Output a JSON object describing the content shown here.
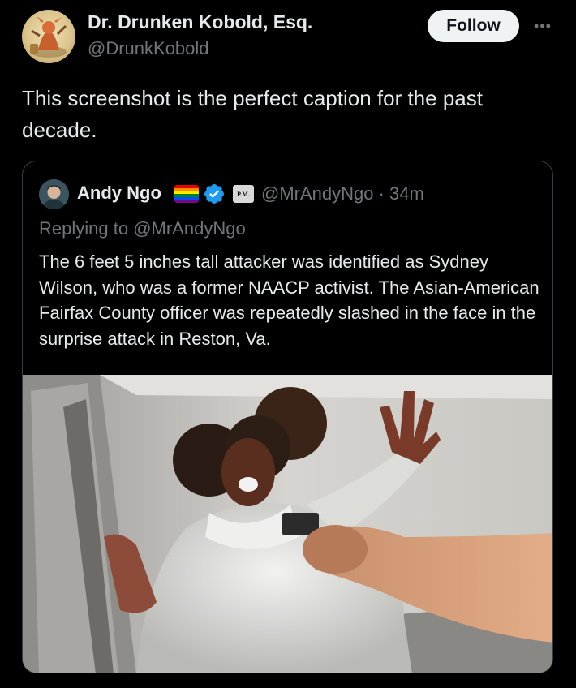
{
  "author": {
    "name": "Dr. Drunken Kobold, Esq.",
    "handle": "@DrunkKobold"
  },
  "actions": {
    "follow_label": "Follow",
    "more_label": "•••"
  },
  "tweet": {
    "text": "This screenshot is the perfect caption for the past decade."
  },
  "quoted": {
    "name": "Andy Ngo",
    "badge_text": "P.M.",
    "handle_time": "@MrAndyNgo · 34m",
    "replying_prefix": "Replying to ",
    "replying_mention": "@MrAndyNgo",
    "text": "The 6 feet 5 inches tall attacker was identified as Sydney Wilson, who was a former NAACP activist. The Asian-American Fairfax County officer was repeatedly slashed in the face in the surprise attack in Reston, Va."
  },
  "icons": {
    "author_avatar": "kobold-avatar-icon",
    "quoted_avatar": "andy-ngo-avatar-icon",
    "flag": "rainbow-flag-icon",
    "verified": "verified-badge-icon",
    "more": "more-options-icon"
  },
  "colors": {
    "background": "#000000",
    "text": "#e7e9ea",
    "secondary_text": "#71767b",
    "verified_blue": "#1d9bf0",
    "follow_bg": "#eff3f4",
    "quote_border": "#3b3f43"
  }
}
